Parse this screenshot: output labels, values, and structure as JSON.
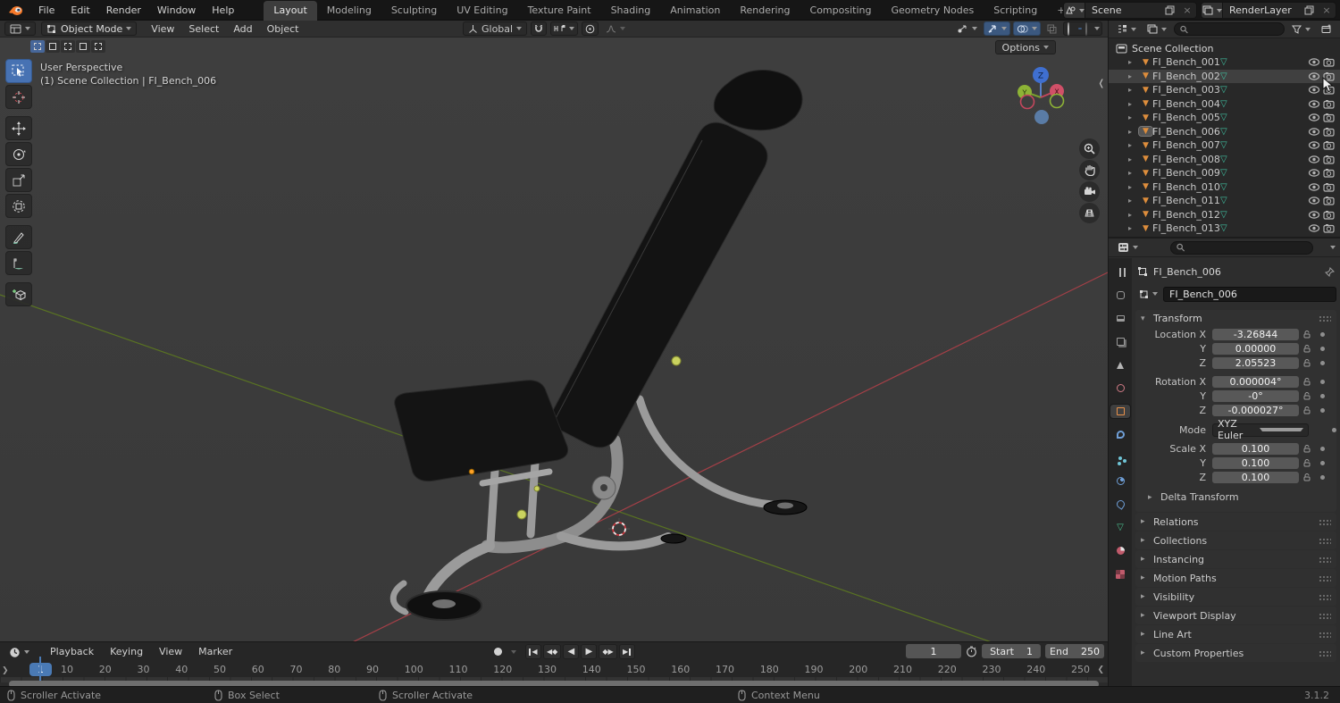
{
  "topbar": {
    "menus": [
      {
        "label": "File"
      },
      {
        "label": "Edit"
      },
      {
        "label": "Render"
      },
      {
        "label": "Window"
      },
      {
        "label": "Help"
      }
    ],
    "workspaces": [
      {
        "label": "Layout",
        "cls": "active"
      },
      {
        "label": "Modeling"
      },
      {
        "label": "Sculpting"
      },
      {
        "label": "UV Editing"
      },
      {
        "label": "Texture Paint"
      },
      {
        "label": "Shading"
      },
      {
        "label": "Animation"
      },
      {
        "label": "Rendering"
      },
      {
        "label": "Compositing"
      },
      {
        "label": "Geometry Nodes"
      },
      {
        "label": "Scripting"
      },
      {
        "label": "+",
        "cls": "plus"
      }
    ],
    "scene_selector": {
      "value": "Scene",
      "close": "×"
    },
    "layer_selector": {
      "value": "RenderLayer",
      "close": "×"
    }
  },
  "viewport": {
    "header": {
      "mode_value": "Object Mode",
      "menus": [
        {
          "label": "View"
        },
        {
          "label": "Select"
        },
        {
          "label": "Add"
        },
        {
          "label": "Object"
        }
      ],
      "orientation_value": "Global"
    },
    "overlay": {
      "view_label": "User Perspective",
      "context_label": "(1) Scene Collection | FI_Bench_006",
      "options_label": "Options"
    },
    "gizmo_axes": {
      "x": "X",
      "y": "Y",
      "z": "Z"
    },
    "colors": {
      "axis_x": "#b04049",
      "axis_y": "#5f7d1e",
      "accent": "#4772b3"
    }
  },
  "outliner": {
    "root_label": "Scene Collection",
    "search_placeholder": "",
    "items": [
      {
        "label": "FI_Bench_001"
      },
      {
        "label": "FI_Bench_002",
        "cls": "hover"
      },
      {
        "label": "FI_Bench_003"
      },
      {
        "label": "FI_Bench_004"
      },
      {
        "label": "FI_Bench_005"
      },
      {
        "label": "FI_Bench_006",
        "cls": "active-obj"
      },
      {
        "label": "FI_Bench_007"
      },
      {
        "label": "FI_Bench_008"
      },
      {
        "label": "FI_Bench_009"
      },
      {
        "label": "FI_Bench_010"
      },
      {
        "label": "FI_Bench_011"
      },
      {
        "label": "FI_Bench_012"
      },
      {
        "label": "FI_Bench_013"
      }
    ]
  },
  "properties": {
    "search_placeholder": "",
    "breadcrumb": "FI_Bench_006",
    "name_value": "FI_Bench_006",
    "transform": {
      "title": "Transform",
      "location_rows": [
        {
          "label": "Location X",
          "value": "-3.26844"
        },
        {
          "label": "Y",
          "value": "0.00000"
        },
        {
          "label": "Z",
          "value": "2.05523"
        }
      ],
      "rotation_rows": [
        {
          "label": "Rotation X",
          "value": "0.000004°"
        },
        {
          "label": "Y",
          "value": "-0°"
        },
        {
          "label": "Z",
          "value": "-0.000027°"
        }
      ],
      "mode_label": "Mode",
      "mode_value": "XYZ Euler",
      "scale_rows": [
        {
          "label": "Scale X",
          "value": "0.100"
        },
        {
          "label": "Y",
          "value": "0.100"
        },
        {
          "label": "Z",
          "value": "0.100"
        }
      ],
      "delta_label": "Delta Transform"
    },
    "panels": [
      {
        "label": "Relations"
      },
      {
        "label": "Collections"
      },
      {
        "label": "Instancing"
      },
      {
        "label": "Motion Paths"
      },
      {
        "label": "Visibility"
      },
      {
        "label": "Viewport Display"
      },
      {
        "label": "Line Art"
      },
      {
        "label": "Custom Properties"
      }
    ]
  },
  "timeline": {
    "menus": [
      {
        "label": "Playback",
        "cls": "has-caret"
      },
      {
        "label": "Keying",
        "cls": "has-caret"
      },
      {
        "label": "View"
      },
      {
        "label": "Marker"
      }
    ],
    "current_frame": "1",
    "frame_field_value": "1",
    "start_label": "Start",
    "start_value": "1",
    "end_label": "End",
    "end_value": "250",
    "ruler_labels": [
      {
        "label": "10"
      },
      {
        "label": "20"
      },
      {
        "label": "30"
      },
      {
        "label": "40"
      },
      {
        "label": "50"
      },
      {
        "label": "60"
      },
      {
        "label": "70"
      },
      {
        "label": "80"
      },
      {
        "label": "90"
      },
      {
        "label": "100"
      },
      {
        "label": "110"
      },
      {
        "label": "120"
      },
      {
        "label": "130"
      },
      {
        "label": "140"
      },
      {
        "label": "150"
      },
      {
        "label": "160"
      },
      {
        "label": "170"
      },
      {
        "label": "180"
      },
      {
        "label": "190"
      },
      {
        "label": "200"
      },
      {
        "label": "210"
      },
      {
        "label": "220"
      },
      {
        "label": "230"
      },
      {
        "label": "240"
      },
      {
        "label": "250"
      }
    ]
  },
  "status_bar": {
    "hints": [
      {
        "label": "Scroller Activate"
      },
      {
        "label": "Box Select"
      },
      {
        "label": "Scroller Activate"
      },
      {
        "label": "Context Menu"
      }
    ],
    "version": "3.1.2"
  },
  "icons": {
    "eye": "visibility-eye",
    "camera": "render-visibility-camera",
    "search": "magnifier",
    "filter": "funnel",
    "magnet": "snapping-magnet",
    "lock": "open-padlock",
    "shading": [
      "wireframe-globe",
      "solid-sphere",
      "material-sphere",
      "rendered-sphere"
    ]
  }
}
